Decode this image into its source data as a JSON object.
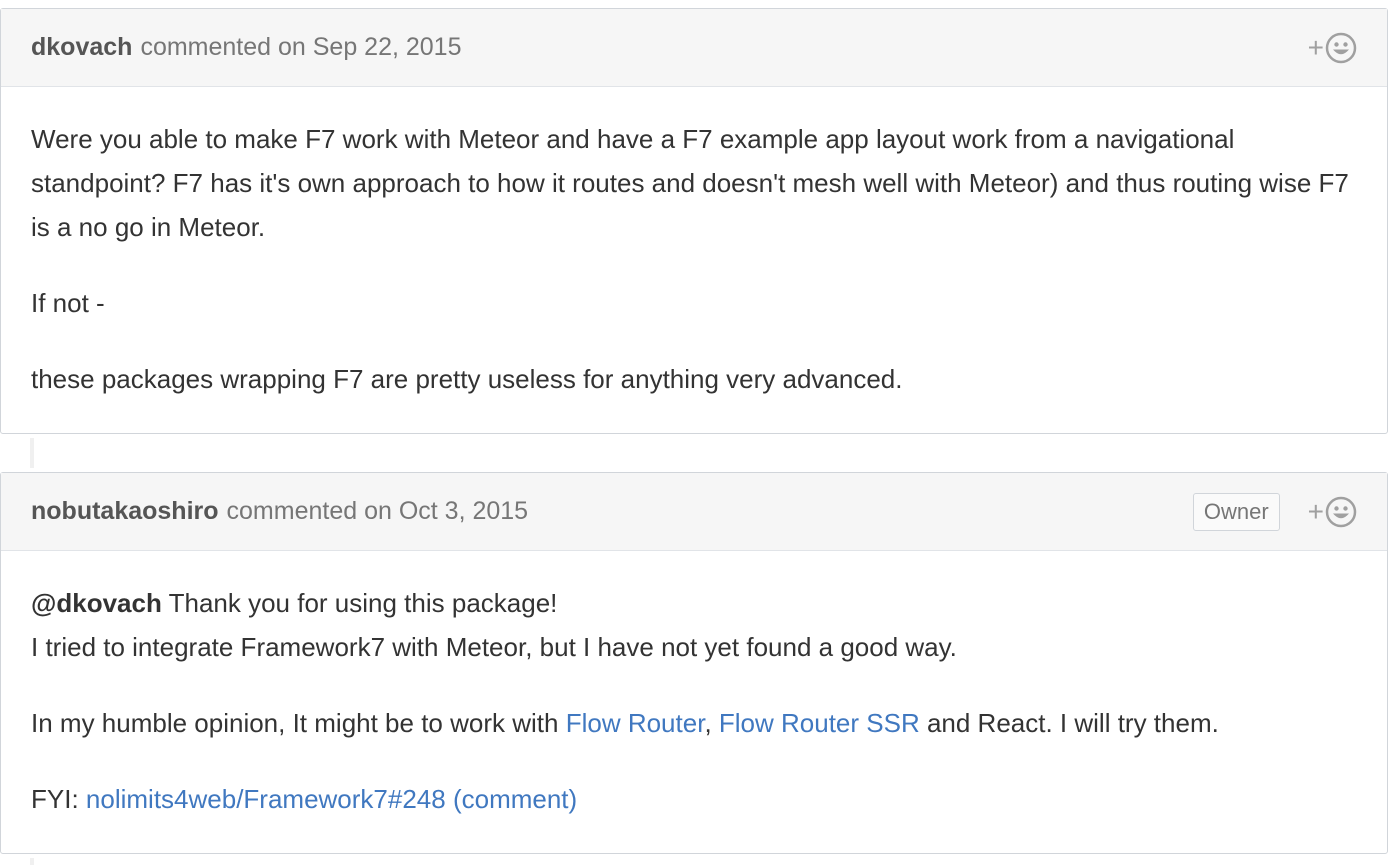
{
  "comments": [
    {
      "author": "dkovach",
      "meta": "commented on Sep 22, 2015",
      "reaction_plus": "+",
      "paragraphs": [
        "Were you able to make F7 work with Meteor and have a F7 example app layout work from a navigational standpoint? F7 has it's own approach to how it routes and doesn't mesh well with Meteor) and thus routing wise F7 is a no go in Meteor.",
        "If not -",
        "these packages wrapping F7 are pretty useless for anything very advanced."
      ]
    },
    {
      "author": "nobutakaoshiro",
      "meta": "commented on Oct 3, 2015",
      "badge": "Owner",
      "reaction_plus": "+",
      "mention": "@dkovach",
      "line1_rest": " Thank you for using this package!",
      "line2": "I tried to integrate Framework7 with Meteor, but I have not yet found a good way.",
      "p2_start": "In my humble opinion, It might be to work with ",
      "link_flow_router": "Flow Router",
      "p2_sep": ", ",
      "link_flow_router_ssr": "Flow Router SSR",
      "p2_end": " and React. I will try them.",
      "fyi_label": "FYI: ",
      "fyi_link": "nolimits4web/Framework7#248 (comment)"
    }
  ],
  "colors": {
    "link": "#4078c0",
    "header_bg": "#f6f6f6",
    "border": "#d1d5da"
  },
  "icons": {
    "reaction": "smiley-icon"
  }
}
